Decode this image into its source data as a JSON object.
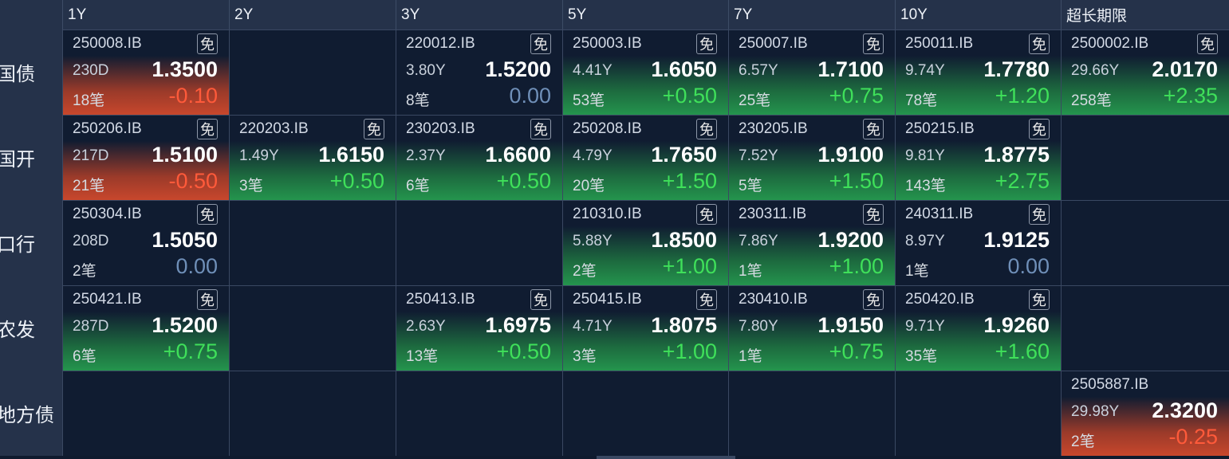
{
  "columns": [
    "1Y",
    "2Y",
    "3Y",
    "5Y",
    "7Y",
    "10Y",
    "超长期限"
  ],
  "rows": [
    {
      "label": "国债",
      "cells": [
        {
          "code": "250008.IB",
          "tag": "免",
          "term": "230D",
          "yield": "1.3500",
          "count": "18笔",
          "change": "-0.10",
          "trend": "red"
        },
        null,
        {
          "code": "220012.IB",
          "tag": "免",
          "term": "3.80Y",
          "yield": "1.5200",
          "count": "8笔",
          "change": "0.00",
          "trend": "flat"
        },
        {
          "code": "250003.IB",
          "tag": "免",
          "term": "4.41Y",
          "yield": "1.6050",
          "count": "53笔",
          "change": "+0.50",
          "trend": "green"
        },
        {
          "code": "250007.IB",
          "tag": "免",
          "term": "6.57Y",
          "yield": "1.7100",
          "count": "25笔",
          "change": "+0.75",
          "trend": "green"
        },
        {
          "code": "250011.IB",
          "tag": "免",
          "term": "9.74Y",
          "yield": "1.7780",
          "count": "78笔",
          "change": "+1.20",
          "trend": "green"
        },
        {
          "code": "2500002.IB",
          "tag": "免",
          "term": "29.66Y",
          "yield": "2.0170",
          "count": "258笔",
          "change": "+2.35",
          "trend": "green"
        }
      ]
    },
    {
      "label": "国开",
      "cells": [
        {
          "code": "250206.IB",
          "tag": "免",
          "term": "217D",
          "yield": "1.5100",
          "count": "21笔",
          "change": "-0.50",
          "trend": "red"
        },
        {
          "code": "220203.IB",
          "tag": "免",
          "term": "1.49Y",
          "yield": "1.6150",
          "count": "3笔",
          "change": "+0.50",
          "trend": "green"
        },
        {
          "code": "230203.IB",
          "tag": "免",
          "term": "2.37Y",
          "yield": "1.6600",
          "count": "6笔",
          "change": "+0.50",
          "trend": "green"
        },
        {
          "code": "250208.IB",
          "tag": "免",
          "term": "4.79Y",
          "yield": "1.7650",
          "count": "20笔",
          "change": "+1.50",
          "trend": "green"
        },
        {
          "code": "230205.IB",
          "tag": "免",
          "term": "7.52Y",
          "yield": "1.9100",
          "count": "5笔",
          "change": "+1.50",
          "trend": "green"
        },
        {
          "code": "250215.IB",
          "tag": "免",
          "term": "9.81Y",
          "yield": "1.8775",
          "count": "143笔",
          "change": "+2.75",
          "trend": "green"
        },
        null
      ]
    },
    {
      "label": "口行",
      "cells": [
        {
          "code": "250304.IB",
          "tag": "免",
          "term": "208D",
          "yield": "1.5050",
          "count": "2笔",
          "change": "0.00",
          "trend": "flat"
        },
        null,
        null,
        {
          "code": "210310.IB",
          "tag": "免",
          "term": "5.88Y",
          "yield": "1.8500",
          "count": "2笔",
          "change": "+1.00",
          "trend": "green"
        },
        {
          "code": "230311.IB",
          "tag": "免",
          "term": "7.86Y",
          "yield": "1.9200",
          "count": "1笔",
          "change": "+1.00",
          "trend": "green"
        },
        {
          "code": "240311.IB",
          "tag": "免",
          "term": "8.97Y",
          "yield": "1.9125",
          "count": "1笔",
          "change": "0.00",
          "trend": "flat"
        },
        null
      ]
    },
    {
      "label": "农发",
      "cells": [
        {
          "code": "250421.IB",
          "tag": "免",
          "term": "287D",
          "yield": "1.5200",
          "count": "6笔",
          "change": "+0.75",
          "trend": "green"
        },
        null,
        {
          "code": "250413.IB",
          "tag": "免",
          "term": "2.63Y",
          "yield": "1.6975",
          "count": "13笔",
          "change": "+0.50",
          "trend": "green"
        },
        {
          "code": "250415.IB",
          "tag": "免",
          "term": "4.71Y",
          "yield": "1.8075",
          "count": "3笔",
          "change": "+1.00",
          "trend": "green"
        },
        {
          "code": "230410.IB",
          "tag": "免",
          "term": "7.80Y",
          "yield": "1.9150",
          "count": "1笔",
          "change": "+0.75",
          "trend": "green"
        },
        {
          "code": "250420.IB",
          "tag": "免",
          "term": "9.71Y",
          "yield": "1.9260",
          "count": "35笔",
          "change": "+1.60",
          "trend": "green"
        },
        null
      ]
    },
    {
      "label": "地方债",
      "cells": [
        null,
        null,
        null,
        null,
        null,
        null,
        {
          "code": "2505887.IB",
          "tag": "",
          "term": "29.98Y",
          "yield": "2.3200",
          "count": "2笔",
          "change": "-0.25",
          "trend": "red"
        }
      ]
    }
  ]
}
